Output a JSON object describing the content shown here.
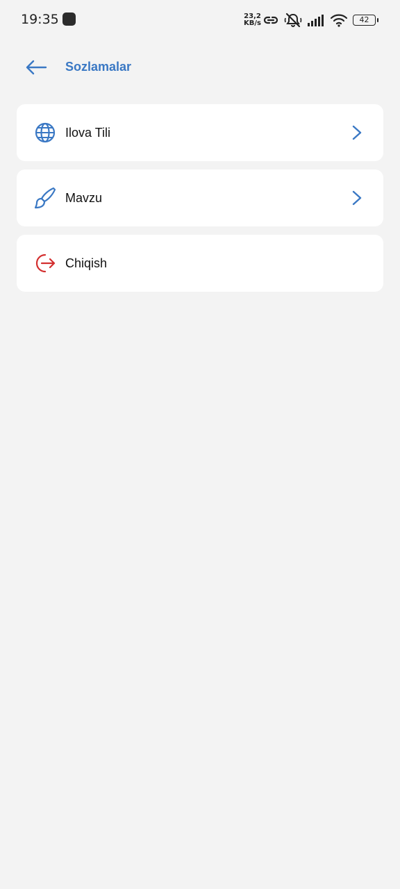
{
  "status_bar": {
    "time": "19:35",
    "speed_value": "23,2",
    "speed_unit": "KB/s",
    "battery": "42"
  },
  "header": {
    "title": "Sozlamalar"
  },
  "settings": {
    "items": [
      {
        "label": "Ilova Tili",
        "icon": "globe-icon"
      },
      {
        "label": "Mavzu",
        "icon": "brush-icon"
      },
      {
        "label": "Chiqish",
        "icon": "logout-icon"
      }
    ]
  },
  "colors": {
    "accent": "#3a78c4",
    "danger": "#d32f2f",
    "background": "#f3f3f3",
    "card": "#ffffff"
  }
}
